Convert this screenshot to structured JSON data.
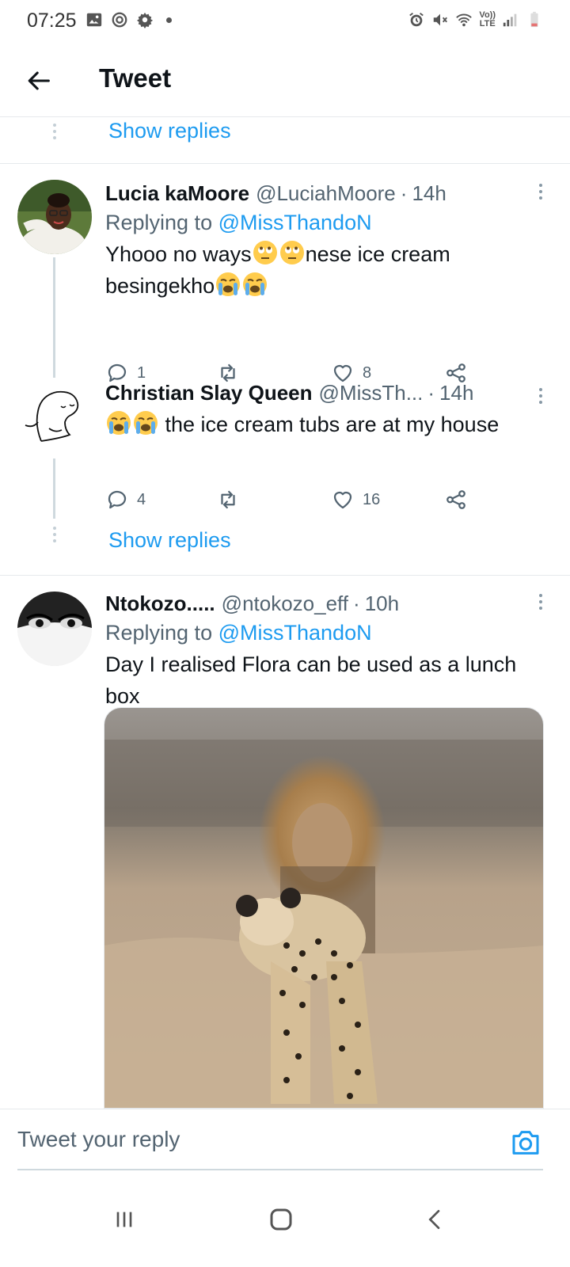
{
  "status_bar": {
    "time": "07:25",
    "left_icons": [
      "image-icon",
      "sync-icon",
      "gear-icon",
      "dot-icon"
    ],
    "right_icons": [
      "alarm-icon",
      "mute-icon",
      "wifi-icon",
      "volte-icon",
      "signal-icon",
      "battery-icon"
    ],
    "volte_label_top": "Vo))",
    "volte_label_bottom": "LTE"
  },
  "header": {
    "title": "Tweet"
  },
  "thread_top": {
    "show_replies": "Show replies"
  },
  "tweets": [
    {
      "name": "Lucia kaMoore",
      "handle": "@LuciahMoore",
      "separator": "·",
      "time": "14h",
      "replying_prefix": "Replying to",
      "replying_to": "@MissThandoN",
      "text_part1": "Yhooo no ways",
      "text_part2": "nese ice cream besingekho",
      "emojis": [
        "rolling-eyes-emoji",
        "rolling-eyes-emoji",
        "crying-emoji",
        "crying-emoji"
      ],
      "replies": "1",
      "retweets": "",
      "likes": "8"
    },
    {
      "name": "Christian Slay Queen",
      "handle": "@MissTh...",
      "separator": "·",
      "time": "14h",
      "text": "the ice cream tubs are at my house",
      "emojis": [
        "crying-emoji",
        "crying-emoji"
      ],
      "replies": "4",
      "retweets": "",
      "likes": "16",
      "show_replies": "Show replies"
    },
    {
      "name": "Ntokozo.....",
      "handle": "@ntokozo_eff",
      "separator": "·",
      "time": "10h",
      "replying_prefix": "Replying to",
      "replying_to": "@MissThandoN",
      "text": "Day I realised Flora can be used as a lunch box",
      "media": "photo of a cheetah with a lion in the background"
    }
  ],
  "composer": {
    "placeholder": "Tweet your reply"
  },
  "navbar": {
    "items": [
      "recent-apps-icon",
      "home-icon",
      "back-icon"
    ]
  },
  "colors": {
    "accent": "#1d9bf0",
    "text_primary": "#0f1419",
    "text_secondary": "#536471",
    "divider": "#e6e9ec"
  }
}
